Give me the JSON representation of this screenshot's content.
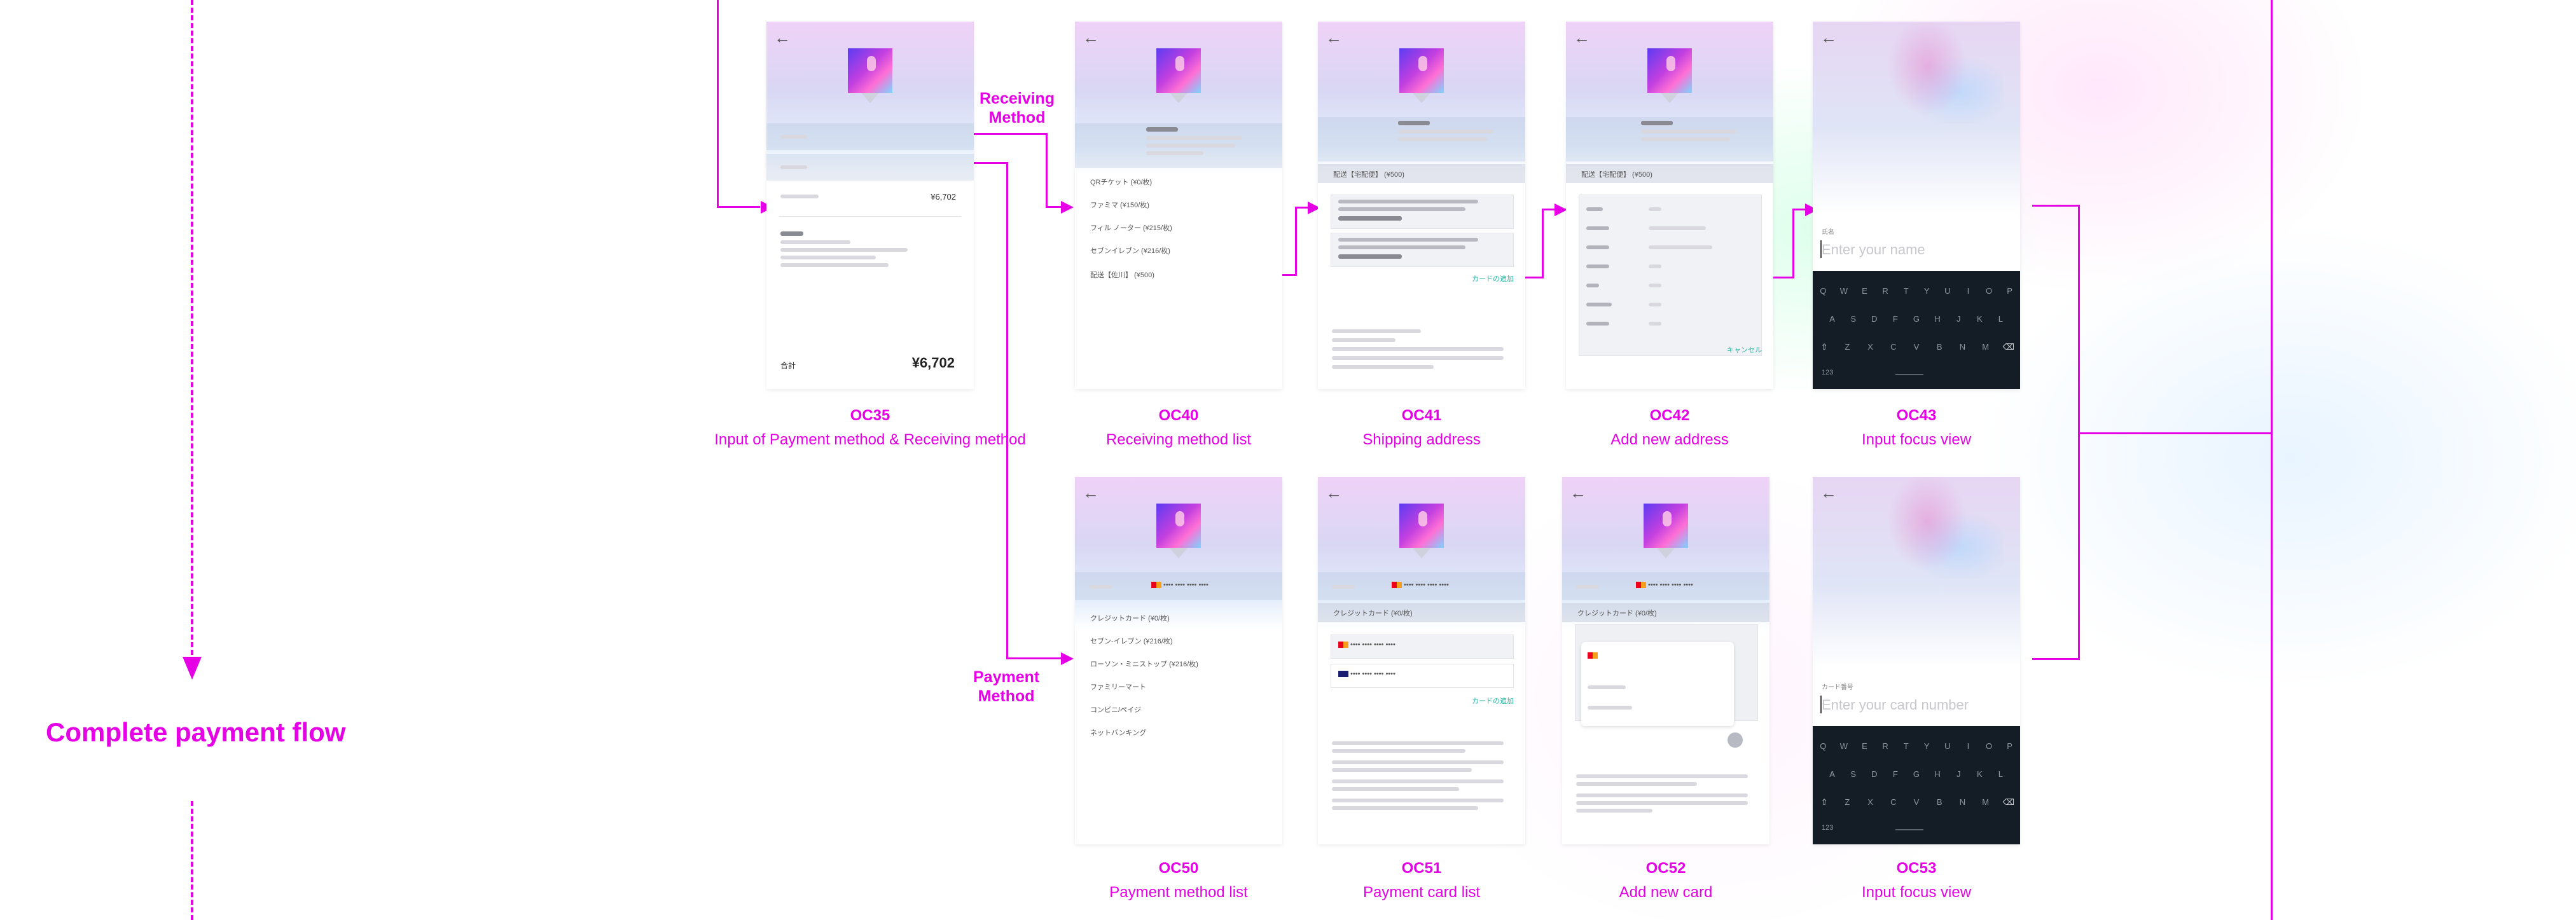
{
  "flow_title": "Complete payment flow",
  "branch_labels": {
    "receiving": "Receiving\nMethod",
    "payment": "Payment\nMethod"
  },
  "screens": {
    "OC35": {
      "id": "OC35",
      "caption": "Input of Payment method & Receiving method",
      "price": "¥6,702",
      "total_label": "合計",
      "total": "¥6,702"
    },
    "OC40": {
      "id": "OC40",
      "caption": "Receiving method list",
      "options": [
        "QRチケット (¥0/枚)",
        "ファミマ (¥150/枚)",
        "フィル ノーター (¥215/枚)",
        "セブンイレブン (¥216/枚)",
        "配送【佐川】 (¥500)"
      ]
    },
    "OC41": {
      "id": "OC41",
      "caption": "Shipping address",
      "section": "配送【宅配便】 (¥500)",
      "add_link": "カードの追加"
    },
    "OC42": {
      "id": "OC42",
      "caption": "Add new address",
      "section": "配送【宅配便】 (¥500)",
      "cancel": "キャンセル"
    },
    "OC43": {
      "id": "OC43",
      "caption": "Input focus view",
      "placeholder": "Enter your name",
      "field_label": "氏名"
    },
    "OC50": {
      "id": "OC50",
      "caption": "Payment method list",
      "options": [
        "クレジットカード (¥0/枚)",
        "セブン-イレブン (¥216/枚)",
        "ローソン・ミニストップ (¥216/枚)",
        "ファミリーマート",
        "コンビニ/ペイジ",
        "ネットバンキング"
      ]
    },
    "OC51": {
      "id": "OC51",
      "caption": "Payment card list",
      "section": "クレジットカード (¥0/枚)",
      "add_link": "カードの追加"
    },
    "OC52": {
      "id": "OC52",
      "caption": "Add new card",
      "section": "クレジットカード (¥0/枚)"
    },
    "OC53": {
      "id": "OC53",
      "caption": "Input focus view",
      "placeholder": "Enter your card number",
      "field_label": "カード番号"
    }
  },
  "keyboard": {
    "row1": [
      "Q",
      "W",
      "E",
      "R",
      "T",
      "Y",
      "U",
      "I",
      "O",
      "P"
    ],
    "row2": [
      "A",
      "S",
      "D",
      "F",
      "G",
      "H",
      "J",
      "K",
      "L"
    ],
    "row3": [
      "⇧",
      "Z",
      "X",
      "C",
      "V",
      "B",
      "N",
      "M",
      "⌫"
    ],
    "bottom_left": "123"
  },
  "colors": {
    "accent": "#e600e6",
    "keyboard_bg": "#141d25",
    "link_teal": "#27b5a0"
  }
}
